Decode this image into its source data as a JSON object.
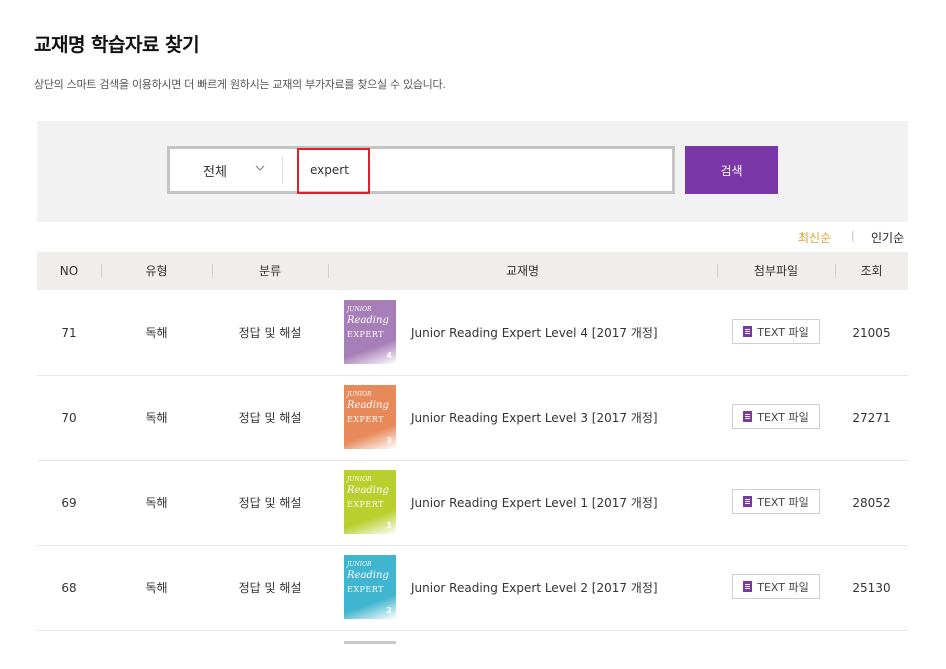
{
  "page": {
    "title": "교재명 학습자료 찾기",
    "description": "상단의 스마트 검색을 이용하시면 더 빠르게 원하시는 교재의 부가자료를 찾으실 수 있습니다."
  },
  "search": {
    "category": "전체",
    "query": "expert",
    "button_label": "검색",
    "accent_color": "#7b36a8",
    "highlight_color": "#e0202a"
  },
  "sort": {
    "latest": "최신순",
    "separator": "|",
    "popular": "인기순",
    "active_color": "#e0a020"
  },
  "table": {
    "headers": {
      "no": "NO",
      "type": "유형",
      "category": "분류",
      "title": "교재명",
      "attachment": "첨부파일",
      "views": "조회"
    },
    "rows": [
      {
        "no": "71",
        "type": "독해",
        "category": "정답 및 해설",
        "title": "Junior Reading Expert Level 4 [2017 개정]",
        "file": "TEXT 파일",
        "views": "21005",
        "cover_color": "#a77fb8",
        "cover_level": "4"
      },
      {
        "no": "70",
        "type": "독해",
        "category": "정답 및 해설",
        "title": "Junior Reading Expert Level 3 [2017 개정]",
        "file": "TEXT 파일",
        "views": "27271",
        "cover_color": "#e8895a",
        "cover_level": "3"
      },
      {
        "no": "69",
        "type": "독해",
        "category": "정답 및 해설",
        "title": "Junior Reading Expert Level 1 [2017 개정]",
        "file": "TEXT 파일",
        "views": "28052",
        "cover_color": "#b9cf2e",
        "cover_level": "1"
      },
      {
        "no": "68",
        "type": "독해",
        "category": "정답 및 해설",
        "title": "Junior Reading Expert Level 2 [2017 개정]",
        "file": "TEXT 파일",
        "views": "25130",
        "cover_color": "#3fb5cf",
        "cover_level": "2"
      }
    ]
  },
  "cover_text": {
    "series": "JUNIOR",
    "word1": "Reading",
    "word2": "EXPERT"
  }
}
